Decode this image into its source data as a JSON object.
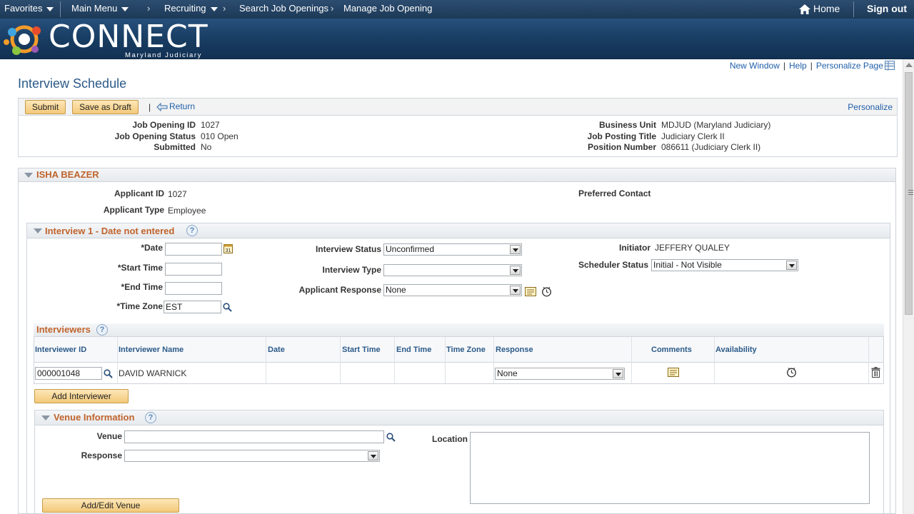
{
  "topnav": {
    "favorites": "Favorites",
    "main_menu": "Main Menu",
    "breadcrumbs": [
      "Recruiting",
      "Search Job Openings",
      "Manage Job Opening"
    ],
    "home": "Home",
    "signout": "Sign out"
  },
  "banner": {
    "logo_text": "CONNECT",
    "logo_sub": "Maryland Judiciary"
  },
  "pagelinks": {
    "new_window": "New Window",
    "help": "Help",
    "personalize_page": "Personalize Page"
  },
  "page_title": "Interview Schedule",
  "toolbar": {
    "submit": "Submit",
    "save_draft": "Save as Draft",
    "pipe": "|",
    "return": "Return",
    "personalize": "Personalize"
  },
  "summary": {
    "job_opening_id_label": "Job Opening ID",
    "job_opening_id": "1027",
    "job_opening_status_label": "Job Opening Status",
    "job_opening_status": "010 Open",
    "submitted_label": "Submitted",
    "submitted": "No",
    "business_unit_label": "Business Unit",
    "business_unit": "MDJUD (Maryland Judiciary)",
    "job_posting_title_label": "Job Posting Title",
    "job_posting_title": "Judiciary Clerk II",
    "position_number_label": "Position Number",
    "position_number": "086611 (Judiciary Clerk II)"
  },
  "applicant": {
    "name": "ISHA BEAZER",
    "applicant_id_label": "Applicant ID",
    "applicant_id": "1027",
    "applicant_type_label": "Applicant Type",
    "applicant_type": "Employee",
    "preferred_contact_label": "Preferred Contact"
  },
  "interview": {
    "header": "Interview 1 - Date not entered",
    "help": "?",
    "date_label": "*Date",
    "date_value": "",
    "start_time_label": "*Start Time",
    "start_time_value": "",
    "end_time_label": "*End Time",
    "end_time_value": "",
    "time_zone_label": "*Time Zone",
    "time_zone_value": "EST",
    "interview_status_label": "Interview Status",
    "interview_status": "Unconfirmed",
    "interview_type_label": "Interview Type",
    "interview_type": "",
    "applicant_response_label": "Applicant Response",
    "applicant_response": "None",
    "initiator_label": "Initiator",
    "initiator": "JEFFERY QUALEY",
    "scheduler_status_label": "Scheduler Status",
    "scheduler_status": "Initial - Not Visible",
    "calendar_day": "31"
  },
  "interviewers": {
    "title": "Interviewers",
    "help": "?",
    "columns": [
      "Interviewer ID",
      "Interviewer Name",
      "Date",
      "Start Time",
      "End Time",
      "Time Zone",
      "Response",
      "Comments",
      "Availability"
    ],
    "rows": [
      {
        "id": "000001048",
        "name": "DAVID WARNICK",
        "date": "",
        "start": "",
        "end": "",
        "tz": "",
        "response": "None"
      }
    ],
    "add_button": "Add Interviewer"
  },
  "venue": {
    "title": "Venue Information",
    "help": "?",
    "venue_label": "Venue",
    "venue_value": "",
    "response_label": "Response",
    "response_value": "",
    "location_label": "Location",
    "location_value": "",
    "add_edit_button": "Add/Edit Venue"
  },
  "colors": {
    "nav": "#1c3957",
    "banner": "#173a5f",
    "link": "#1f5fa8",
    "section_title": "#c0632b",
    "button": "#f3c97a"
  }
}
